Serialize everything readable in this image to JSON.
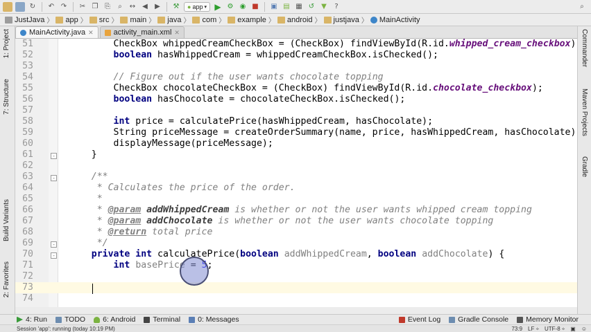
{
  "toolbar": {
    "run_config": "app",
    "icons": [
      "folder-open-icon",
      "save-icon",
      "sync-icon",
      "undo-icon",
      "redo-icon",
      "cut-icon",
      "copy-icon",
      "paste-icon",
      "find-icon",
      "replace-icon",
      "back-icon",
      "forward-icon",
      "run-icon",
      "debug-icon",
      "attach-icon",
      "stop-icon",
      "sdk-icon",
      "avd-icon",
      "help-icon"
    ]
  },
  "breadcrumb": [
    "JustJava",
    "app",
    "src",
    "main",
    "java",
    "com",
    "example",
    "android",
    "justjava",
    "MainActivity"
  ],
  "tabs": [
    {
      "label": "MainActivity.java",
      "active": true
    },
    {
      "label": "activity_main.xml",
      "active": false
    }
  ],
  "left_tools": [
    "1: Project",
    "7: Structure",
    "Build Variants",
    "2: Favorites"
  ],
  "right_tools": [
    "Commander",
    "Maven Projects",
    "Gradle"
  ],
  "lines": [
    {
      "n": "51",
      "html": "        CheckBox whippedCreamCheckBox = (CheckBox) findViewById(R.id.<span class='fd'>whipped_cream_checkbox</span>);"
    },
    {
      "n": "52",
      "html": "        <span class='kw'>boolean</span> hasWhippedCream = whippedCreamCheckBox.isChecked();"
    },
    {
      "n": "53",
      "html": ""
    },
    {
      "n": "54",
      "html": "        <span class='cm'>// Figure out if the user wants chocolate topping</span>"
    },
    {
      "n": "55",
      "html": "        CheckBox chocolateCheckBox = (CheckBox) findViewById(R.id.<span class='fd'>chocolate_checkbox</span>);"
    },
    {
      "n": "56",
      "html": "        <span class='kw'>boolean</span> hasChocolate = chocolateCheckBox.isChecked();"
    },
    {
      "n": "57",
      "html": ""
    },
    {
      "n": "58",
      "html": "        <span class='kw'>int</span> price = calculatePrice(hasWhippedCream, hasChocolate);"
    },
    {
      "n": "59",
      "html": "        String priceMessage = createOrderSummary(name, price, hasWhippedCream, hasChocolate);"
    },
    {
      "n": "60",
      "html": "        displayMessage(priceMessage);"
    },
    {
      "n": "61",
      "html": "    }"
    },
    {
      "n": "62",
      "html": ""
    },
    {
      "n": "63",
      "html": "    <span class='cm'>/**</span>"
    },
    {
      "n": "64",
      "html": "<span class='cm'>     * Calculates the price of the order.</span>"
    },
    {
      "n": "65",
      "html": "<span class='cm'>     *</span>"
    },
    {
      "n": "66",
      "html": "<span class='cm'>     * </span><span class='tag'>@param</span><span class='cm'> </span><span class='pn'>addWhippedCream</span><span class='cm'> is whether or not the user wants whipped cream topping</span>"
    },
    {
      "n": "67",
      "html": "<span class='cm'>     * </span><span class='tag'>@param</span><span class='cm'> </span><span class='pn'>addChocolate</span><span class='cm'> is whether or not the user wants chocolate topping</span>"
    },
    {
      "n": "68",
      "html": "<span class='cm'>     * </span><span class='tag'>@return</span><span class='cm'> total price</span>"
    },
    {
      "n": "69",
      "html": "<span class='cm'>     */</span>"
    },
    {
      "n": "70",
      "html": "    <span class='kw'>private int</span> calculatePrice(<span class='kw'>boolean</span> <span class='pu'>addWhippedCream</span>, <span class='kw'>boolean</span> <span class='pu'>addChocolate</span>) {"
    },
    {
      "n": "71",
      "html": "        <span class='kw'>int</span> <span class='pu'>basePrice</span> = <span class='num'>5</span>;"
    },
    {
      "n": "72",
      "html": ""
    },
    {
      "n": "73",
      "html": ""
    },
    {
      "n": "74",
      "html": ""
    }
  ],
  "bottom_tools": [
    {
      "label": "4: Run",
      "icon": "run-icon",
      "color": "#3a9b3a"
    },
    {
      "label": "TODO",
      "icon": "todo-icon",
      "color": "#6d8db0"
    },
    {
      "label": "6: Android",
      "icon": "android-icon",
      "color": "#7cb342"
    },
    {
      "label": "Terminal",
      "icon": "terminal-icon",
      "color": "#444444"
    },
    {
      "label": "0: Messages",
      "icon": "messages-icon",
      "color": "#5b7fb5"
    }
  ],
  "bottom_right_tools": [
    {
      "label": "Event Log",
      "icon": "event-log-icon",
      "color": "#c0392b"
    },
    {
      "label": "Gradle Console",
      "icon": "gradle-console-icon",
      "color": "#6d8db0"
    },
    {
      "label": "Memory Monitor",
      "icon": "memory-monitor-icon",
      "color": "#555555"
    }
  ],
  "status": {
    "message": "Session 'app': running (today 10:19 PM)",
    "position": "73:9",
    "line_sep": "LF ÷",
    "encoding": "UTF-8 ÷"
  }
}
